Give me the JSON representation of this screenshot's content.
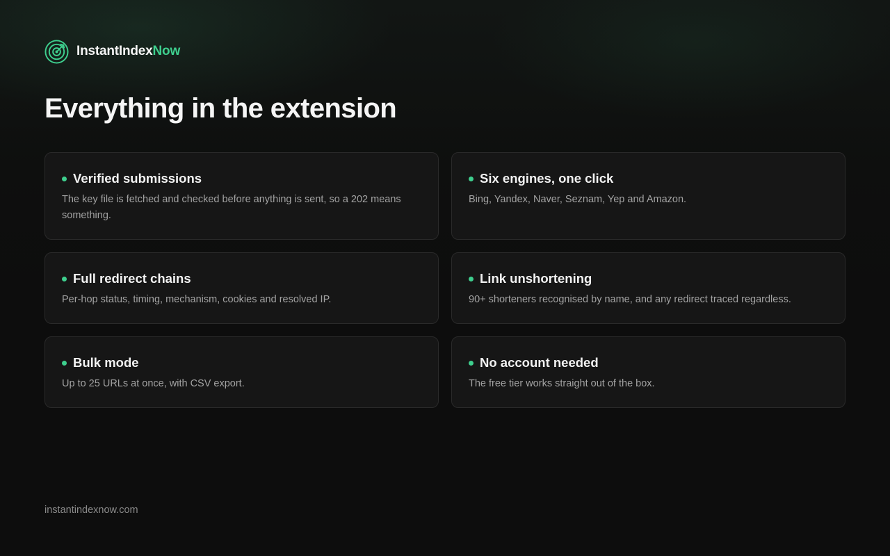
{
  "brand": {
    "name_main": "InstantIndex",
    "name_accent": "Now",
    "logo_icon": "target-radar-icon",
    "accent_color": "#3ecf8e"
  },
  "heading": "Everything in the extension",
  "features": [
    {
      "title": "Verified submissions",
      "description": "The key file is fetched and checked before anything is sent, so a 202 means something."
    },
    {
      "title": "Six engines, one click",
      "description": "Bing, Yandex, Naver, Seznam, Yep and Amazon."
    },
    {
      "title": "Full redirect chains",
      "description": "Per-hop status, timing, mechanism, cookies and resolved IP."
    },
    {
      "title": "Link unshortening",
      "description": "90+ shorteners recognised by name, and any redirect traced regardless."
    },
    {
      "title": "Bulk mode",
      "description": "Up to 25 URLs at once, with CSV export."
    },
    {
      "title": "No account needed",
      "description": "The free tier works straight out of the box."
    }
  ],
  "footer": {
    "domain": "instantindexnow.com"
  }
}
